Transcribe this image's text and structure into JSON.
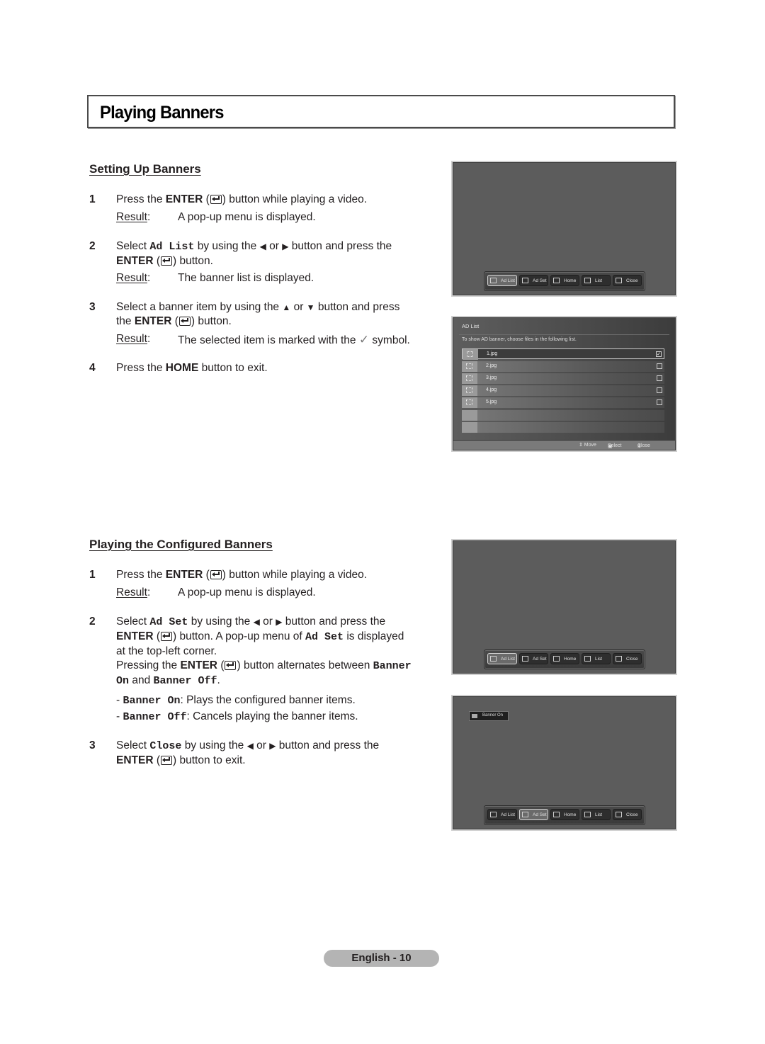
{
  "page_title": "Playing Banners",
  "section1": {
    "heading": "Setting Up Banners",
    "steps": [
      {
        "num": "1",
        "t1": "Press the ",
        "enter": "ENTER",
        "t2": " button while playing a video.",
        "result_label": "Result",
        "result": "A pop-up menu is displayed."
      },
      {
        "num": "2",
        "t1": "Select ",
        "code": "Ad List",
        "t2": " by using the ",
        "left": "◀",
        "or": " or ",
        "right": "▶",
        "t3": " button and press the",
        "enter": "ENTER",
        "t4": " button.",
        "result_label": "Result",
        "result": "The banner list is displayed."
      },
      {
        "num": "3",
        "t1": "Select a banner item by using the ",
        "up": "▲",
        "or": " or ",
        "down": "▼",
        "t2": " button and press",
        "t3": "the ",
        "enter": "ENTER",
        "t4": " button.",
        "result_label": "Result",
        "result_a": "The selected item is marked with the ",
        "check": "✓",
        "result_b": " symbol."
      },
      {
        "num": "4",
        "t1": "Press the ",
        "home": "HOME",
        "t2": " button to exit."
      }
    ]
  },
  "section2": {
    "heading": "Playing the Configured Banners",
    "steps": [
      {
        "num": "1",
        "t1": "Press the ",
        "enter": "ENTER",
        "t2": " button while playing a video.",
        "result_label": "Result",
        "result": "A pop-up menu is displayed."
      },
      {
        "num": "2",
        "t1": "Select ",
        "code": "Ad Set",
        "t2": " by using the ",
        "left": "◀",
        "or": " or ",
        "right": "▶",
        "t3": " button and press the",
        "enter": "ENTER",
        "t4": " button. A pop-up menu of ",
        "code2": "Ad Set",
        "t5": " is displayed",
        "t6": "at the top-left corner.",
        "t7": "Pressing the ",
        "t8": " button alternates between ",
        "code3": "Banner",
        "code4": "On",
        "t9": " and ",
        "code5": "Banner Off",
        "t10": "."
      },
      {
        "num": "3",
        "t1": "Select ",
        "code": "Close",
        "t2": " by using the ",
        "left": "◀",
        "or": " or ",
        "right": "▶",
        "t3": " button and press the",
        "enter": "ENTER",
        "t4": " button to exit."
      }
    ],
    "bullets": [
      {
        "dash": "- ",
        "code": "Banner On",
        "text": ": Plays the configured banner items."
      },
      {
        "dash": "- ",
        "code": "Banner Off",
        "text": ": Cancels playing the banner items."
      }
    ]
  },
  "osd": {
    "buttons": [
      "Ad List",
      "Ad Set",
      "Home",
      "List",
      "Close"
    ]
  },
  "ad_list_screen": {
    "header": "AD List",
    "description": "To show AD banner, choose files in the following list.",
    "files": [
      {
        "name": "1.jpg",
        "checked": "✓"
      },
      {
        "name": "2.jpg",
        "checked": ""
      },
      {
        "name": "3.jpg",
        "checked": ""
      },
      {
        "name": "4.jpg",
        "checked": ""
      },
      {
        "name": "5.jpg",
        "checked": ""
      }
    ],
    "footer": {
      "move": "⇕ Move",
      "select": "Select",
      "close": "Close"
    }
  },
  "banner_popup": "Banner On",
  "footer": {
    "page_label": "English - 10"
  }
}
